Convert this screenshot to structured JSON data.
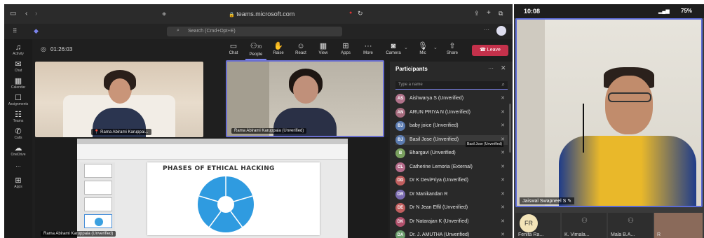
{
  "browser": {
    "url": "teams.microsoft.com"
  },
  "teams": {
    "search_placeholder": "Search (Cmd+Opt+E)",
    "meeting_timer": "01:26:03",
    "rail": [
      "Activity",
      "Chat",
      "Calendar",
      "Assignments",
      "Teams",
      "Calls",
      "OneDrive",
      "...",
      "Apps"
    ],
    "toolbar": {
      "chat": "Chat",
      "people": "People",
      "people_count": "70",
      "raise": "Raise",
      "react": "React",
      "view": "View",
      "apps": "Apps",
      "more": "More",
      "camera": "Camera",
      "mic": "Mic",
      "share": "Share",
      "leave": "Leave"
    },
    "videos": {
      "tile1_name": "Rama Abirami Karuppai...",
      "tile2_name": "Rama Abirami Karuppaia (Unverified)",
      "share_name": "Rama Abirami Karuppaia (Unverified)"
    },
    "slide": {
      "title": "PHASES OF ETHICAL HACKING"
    },
    "participants": {
      "title": "Participants",
      "search_placeholder": "Type a name",
      "tooltip": "Basil Jose (Unverified)",
      "list": [
        {
          "initials": "AS",
          "name": "Aishwarya S (Unverified)",
          "color": "#b0728a"
        },
        {
          "initials": "AN",
          "name": "ARUN PRIYA N (Unverified)",
          "color": "#a56b7d"
        },
        {
          "initials": "BJ",
          "name": "baby joice (Unverified)",
          "color": "#5b7bb0"
        },
        {
          "initials": "BJ",
          "name": "Basil Jose (Unverified)",
          "color": "#5b7bb0"
        },
        {
          "initials": "B",
          "name": "Bhargavi (Unverified)",
          "color": "#7aa05f"
        },
        {
          "initials": "CL",
          "name": "Catherine Lemoria (External)",
          "color": "#b56b8a"
        },
        {
          "initials": "DD",
          "name": "Dr K DeviPriya (Unverified)",
          "color": "#c05e5e"
        },
        {
          "initials": "DR",
          "name": "Dr Manikandan R",
          "color": "#7a6bb0"
        },
        {
          "initials": "DE",
          "name": "Dr N Jean Effil (Unverified)",
          "color": "#c05e5e"
        },
        {
          "initials": "DK",
          "name": "Dr Natarajan K (Unverified)",
          "color": "#b0506b"
        },
        {
          "initials": "DA",
          "name": "Dr. J. AMUTHA (Unverified)",
          "color": "#6a9a6a"
        }
      ]
    }
  },
  "phone": {
    "time": "10:08",
    "battery": "75%",
    "main_name": "Jaiswal Swapneel S",
    "tiles": [
      {
        "initials": "FR",
        "name": "Fenita Ra..."
      },
      {
        "initials": "",
        "name": "K. Vimala..."
      },
      {
        "initials": "",
        "name": "Mala B.A..."
      },
      {
        "initials": "",
        "name": "R"
      }
    ]
  }
}
